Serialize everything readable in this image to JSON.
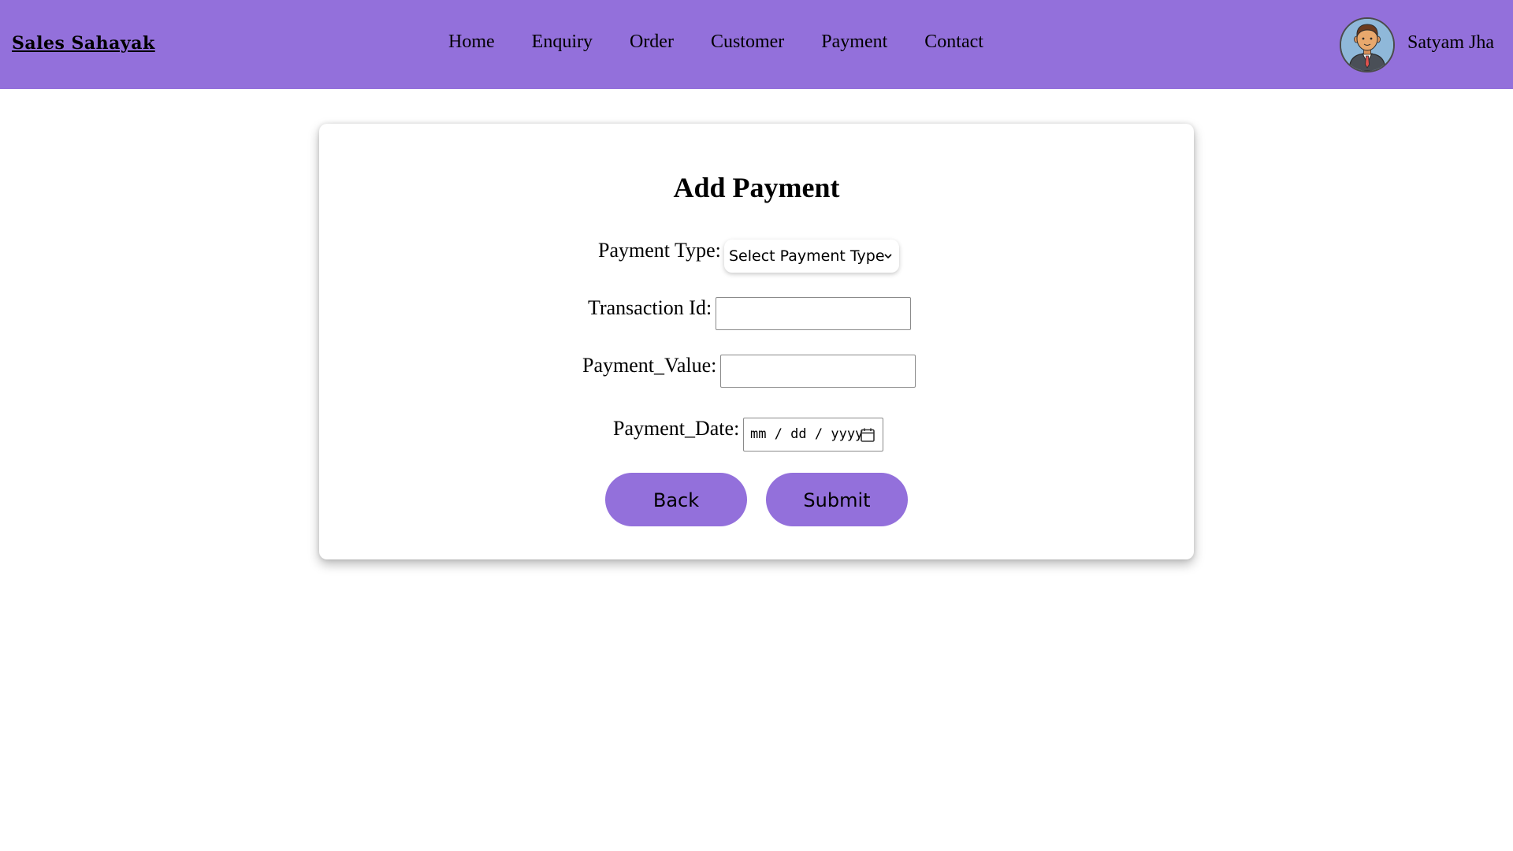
{
  "navbar": {
    "brand": "Sales Sahayak",
    "links": [
      "Home",
      "Enquiry",
      "Order",
      "Customer",
      "Payment",
      "Contact"
    ],
    "user_name": "Satyam Jha",
    "avatar_icon": "user-avatar-icon",
    "background_color": "#9370db"
  },
  "form": {
    "title": "Add Payment",
    "payment_type_label": "Payment Type:",
    "payment_type_selected": "Select Payment Type",
    "transaction_id_label": "Transaction Id:",
    "transaction_id_value": "",
    "payment_value_label": "Payment_Value:",
    "payment_value_value": "",
    "payment_date_label": "Payment_Date:",
    "payment_date_placeholder": "mm / dd / yyyy",
    "back_label": "Back",
    "submit_label": "Submit",
    "button_color": "#9370db"
  }
}
